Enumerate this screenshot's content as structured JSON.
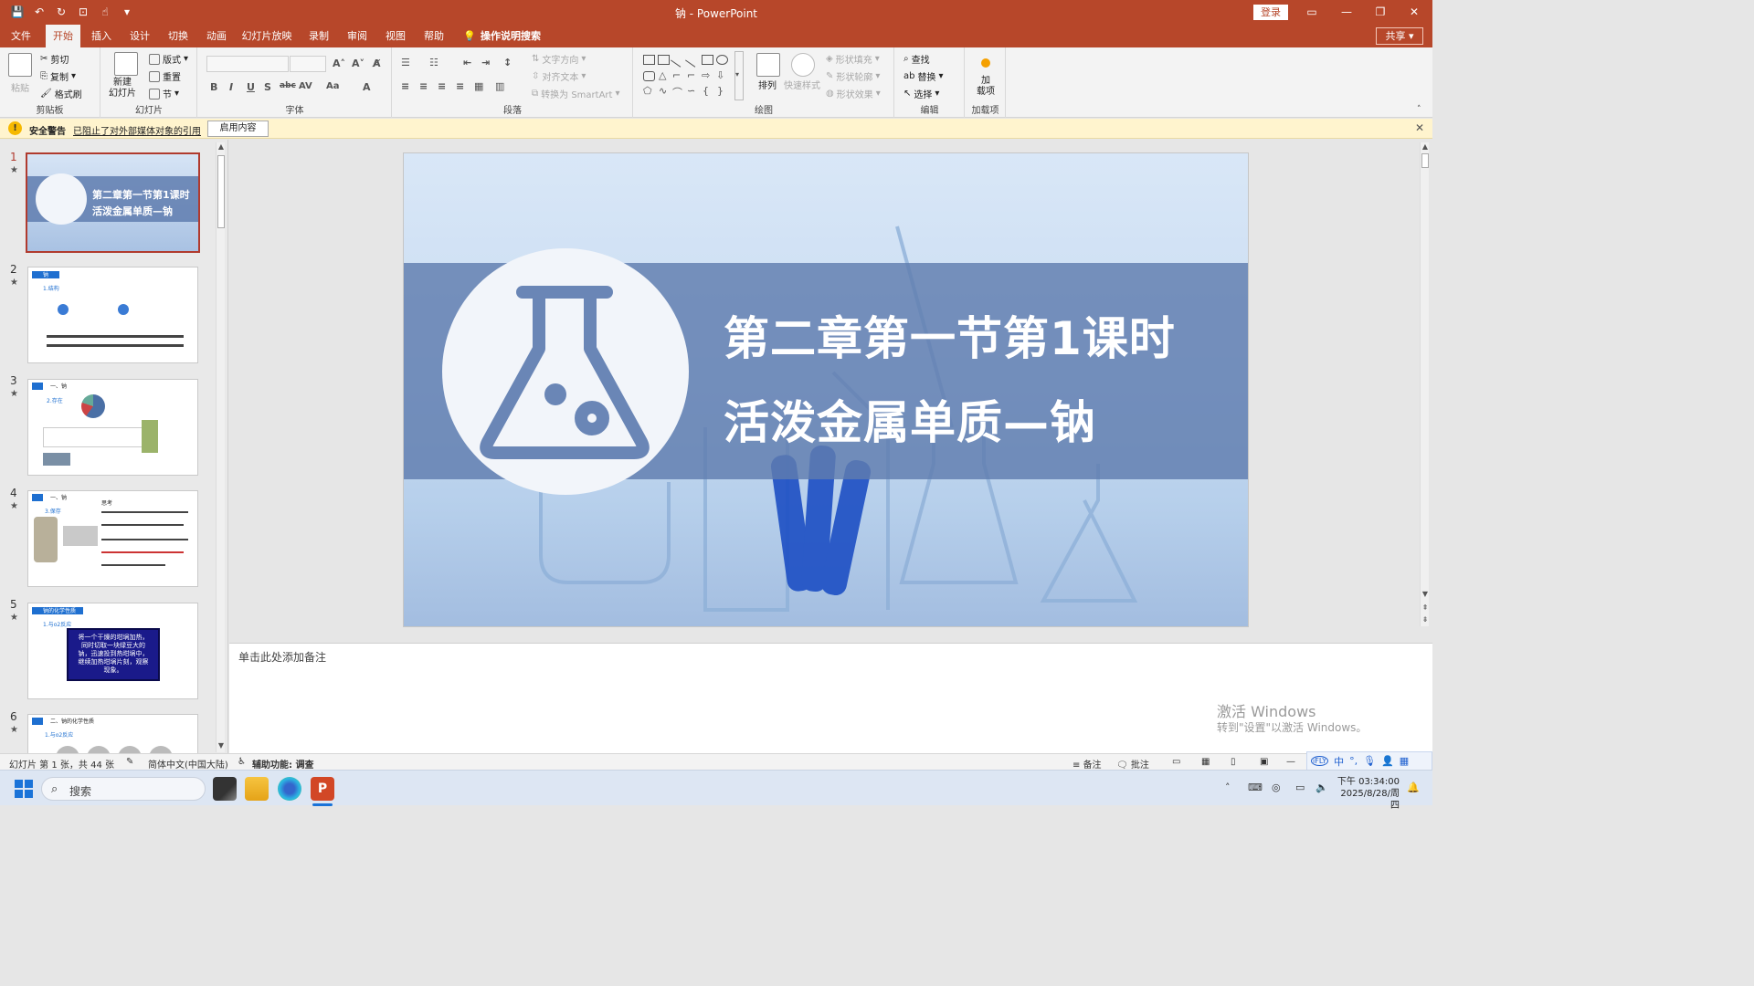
{
  "titlebar": {
    "title": "钠 - PowerPoint",
    "login": "登录"
  },
  "tabs": [
    "文件",
    "开始",
    "插入",
    "设计",
    "切换",
    "动画",
    "幻灯片放映",
    "录制",
    "审阅",
    "视图",
    "帮助"
  ],
  "tell_me": "操作说明搜索",
  "share": "共享",
  "ribbon": {
    "clipboard": {
      "label": "剪贴板",
      "paste": "粘贴",
      "cut": "剪切",
      "copy": "复制",
      "format_painter": "格式刷"
    },
    "slides": {
      "label": "幻灯片",
      "new_slide": "新建\n幻灯片",
      "layout": "版式",
      "reset": "重置",
      "section": "节"
    },
    "font": {
      "label": "字体"
    },
    "paragraph": {
      "label": "段落",
      "text_direction": "文字方向",
      "align_text": "对齐文本",
      "smartart": "转换为 SmartArt"
    },
    "drawing": {
      "label": "绘图",
      "arrange": "排列",
      "quick_styles": "快速样式",
      "shape_fill": "形状填充",
      "shape_outline": "形状轮廓",
      "shape_effects": "形状效果"
    },
    "editing": {
      "label": "编辑",
      "find": "查找",
      "replace": "替换",
      "select": "选择"
    },
    "addins": {
      "label": "加载项",
      "addins_btn": "加\n载项"
    }
  },
  "security_bar": {
    "title": "安全警告",
    "message": "已阻止了对外部媒体对象的引用",
    "enable": "启用内容"
  },
  "thumbnails": [
    {
      "num": "1",
      "title_l1": "第二章第一节第1课时",
      "title_l2": "活泼金属单质—钠"
    },
    {
      "num": "2",
      "heading": "钠",
      "sub": "1.结构"
    },
    {
      "num": "3",
      "heading": "一、钠",
      "sub": "2.存在"
    },
    {
      "num": "4",
      "heading": "一、钠",
      "sub": "3.保存",
      "note": "思考"
    },
    {
      "num": "5",
      "heading": "钠的化学性质",
      "sub": "1.与o2反应",
      "box_text": "将一个干燥的坩埚加热，同时切取一块绿豆大的钠，迅速投到热坩埚中，继续加热坩埚片刻，观察现象。"
    },
    {
      "num": "6",
      "heading": "二、钠的化学性质",
      "sub": "1.与o2反应"
    }
  ],
  "slide": {
    "title_line1": "第二章第一节第1课时",
    "title_line2": "活泼金属单质—钠"
  },
  "notes_placeholder": "单击此处添加备注",
  "watermark": {
    "line1": "激活 Windows",
    "line2": "转到\"设置\"以激活 Windows。"
  },
  "statusbar": {
    "slide_info": "幻灯片 第 1 张，共 44 张",
    "language": "简体中文(中国大陆)",
    "accessibility": "辅助功能: 调查",
    "notes": "备注",
    "comments": "批注"
  },
  "taskbar": {
    "search": "搜索",
    "time": "下午 03:34:00",
    "date": "2025/8/28/周四"
  },
  "colors": {
    "accent": "#b7472a",
    "slide_band": "#5f7daf"
  }
}
